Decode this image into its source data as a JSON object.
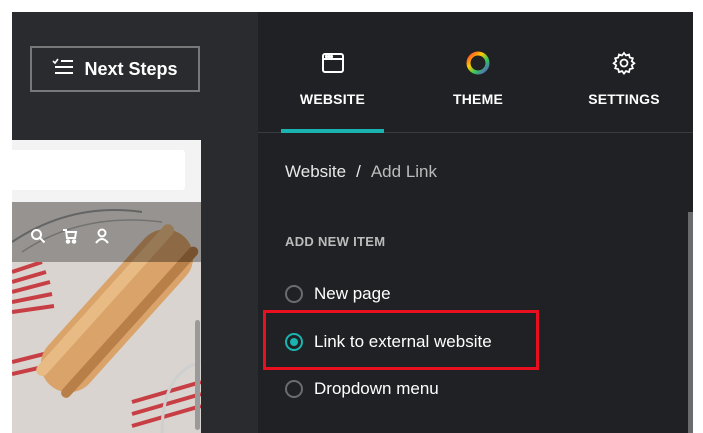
{
  "toolbar": {
    "next_steps_label": "Next Steps",
    "next_steps_icon": "checklist-icon"
  },
  "tabs": [
    {
      "label": "WEBSITE",
      "icon": "browser-window-icon",
      "active": true
    },
    {
      "label": "THEME",
      "icon": "color-wheel-icon",
      "active": false
    },
    {
      "label": "SETTINGS",
      "icon": "gear-icon",
      "active": false
    }
  ],
  "breadcrumb": {
    "root": "Website",
    "separator": "/",
    "current": "Add Link"
  },
  "section": {
    "title": "ADD NEW ITEM"
  },
  "options": [
    {
      "label": "New page",
      "selected": false
    },
    {
      "label": "Link to external website",
      "selected": true
    },
    {
      "label": "Dropdown menu",
      "selected": false
    }
  ],
  "preview": {
    "nav_icons": [
      "search-icon",
      "cart-icon",
      "user-icon"
    ]
  },
  "colors": {
    "accent": "#19b3b0",
    "highlight": "#e8101e",
    "panel_bg": "#202124"
  }
}
